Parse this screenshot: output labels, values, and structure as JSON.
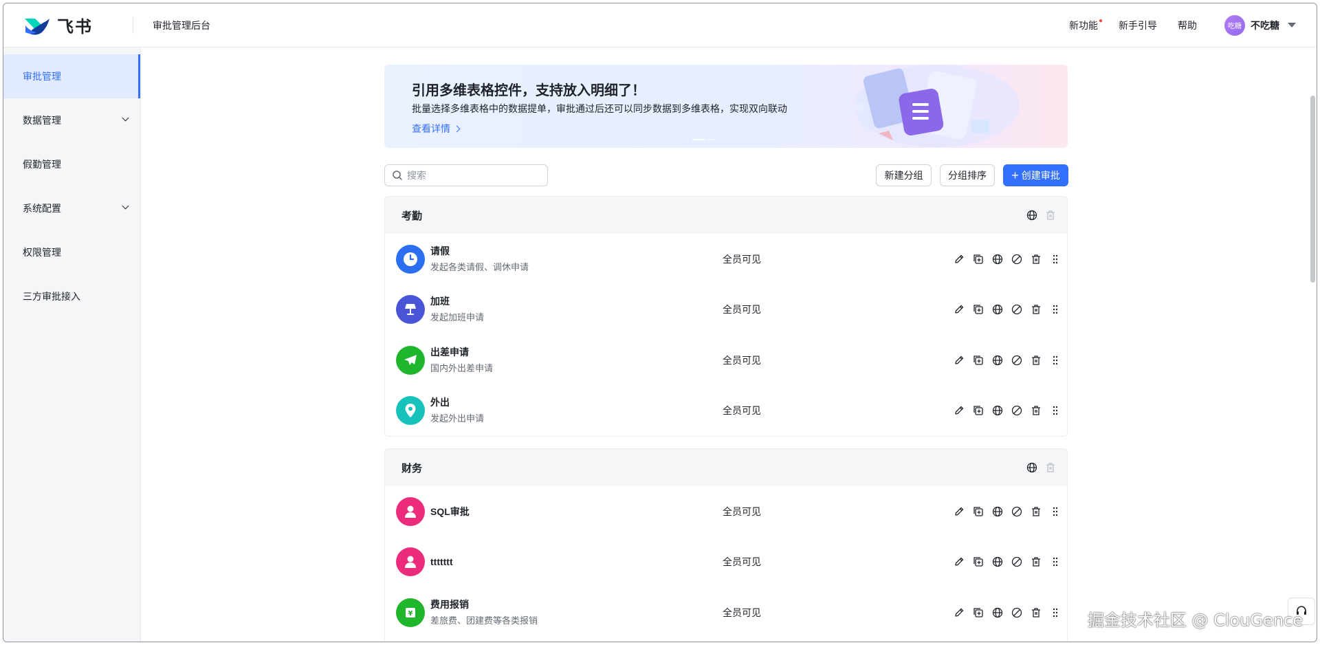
{
  "header": {
    "logo_text": "飞书",
    "title": "审批管理后台",
    "links": [
      {
        "label": "新功能",
        "has_dot": true
      },
      {
        "label": "新手引导"
      },
      {
        "label": "帮助"
      }
    ],
    "user": {
      "avatar_text": "吃糖",
      "name": "不吃糖"
    }
  },
  "sidebar": {
    "items": [
      {
        "label": "审批管理",
        "active": true
      },
      {
        "label": "数据管理",
        "expandable": true
      },
      {
        "label": "假勤管理"
      },
      {
        "label": "系统配置",
        "expandable": true
      },
      {
        "label": "权限管理"
      },
      {
        "label": "三方审批接入"
      }
    ]
  },
  "banner": {
    "title": "引用多维表格控件，支持放入明细了！",
    "description": "批量选择多维表格中的数据提单，审批通过后还可以同步数据到多维表格，实现双向联动",
    "link": "查看详情"
  },
  "toolbar": {
    "search_placeholder": "搜索",
    "new_group": "新建分组",
    "sort_group": "分组排序",
    "create": "创建审批"
  },
  "groups": [
    {
      "title": "考勤",
      "items": [
        {
          "name": "请假",
          "desc": "发起各类请假、调休申请",
          "visibility": "全员可见",
          "icon": "clock-icon",
          "color": "#2b6ef0"
        },
        {
          "name": "加班",
          "desc": "发起加班申请",
          "visibility": "全员可见",
          "icon": "lamp-icon",
          "color": "#4a54d6"
        },
        {
          "name": "出差申请",
          "desc": "国内外出差申请",
          "visibility": "全员可见",
          "icon": "airplane-icon",
          "color": "#1fb62d"
        },
        {
          "name": "外出",
          "desc": "发起外出申请",
          "visibility": "全员可见",
          "icon": "location-pin-icon",
          "color": "#16c2ba"
        }
      ]
    },
    {
      "title": "财务",
      "items": [
        {
          "name": "SQL审批",
          "desc": "",
          "visibility": "全员可见",
          "icon": "person-icon",
          "color": "#eb2c7c"
        },
        {
          "name": "ttttttt",
          "desc": "",
          "visibility": "全员可见",
          "icon": "person-icon",
          "color": "#eb2c7c"
        },
        {
          "name": "费用报销",
          "desc": "差旅费、团建费等各类报销",
          "visibility": "全员可见",
          "icon": "yuan-invoice-icon",
          "color": "#1fb62d"
        }
      ]
    }
  ],
  "watermark": "掘金技术社区 @ ClouGence",
  "colors": {
    "primary": "#3370ff",
    "sidebar_bg": "#f5f6f7",
    "active_bg": "#e1eaff"
  }
}
